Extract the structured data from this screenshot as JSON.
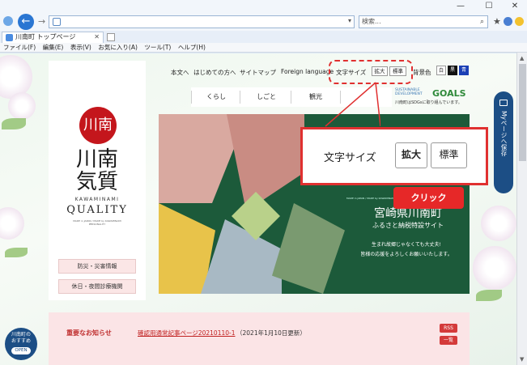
{
  "browser": {
    "tab_title": "川南町 トップページ",
    "search_placeholder": "検索...",
    "menu": [
      "ファイル(F)",
      "編集(E)",
      "表示(V)",
      "お気に入り(A)",
      "ツール(T)",
      "ヘルプ(H)"
    ],
    "controls": {
      "minimize": "—",
      "maximize": "☐",
      "close": "✕"
    }
  },
  "topnav": {
    "links": [
      "本文へ",
      "はじめての方へ",
      "サイトマップ",
      "Foreign language"
    ],
    "font_size_label": "文字サイズ",
    "font_large": "拡大",
    "font_normal": "標準",
    "bg_color_label": "背景色",
    "bg_white": "白",
    "bg_black": "黒",
    "bg_blue": "青"
  },
  "mainnav": [
    "くらし",
    "しごと",
    "観光"
  ],
  "sdg": {
    "top": "SUSTAINABLE DEVELOPMENT",
    "goals": "GOALS",
    "sub": "川南町はSDGsに取り組んでいます。"
  },
  "logo": {
    "mark": "川南",
    "text": "川南\n気質",
    "kana": "KAWAMINAMI",
    "quality": "QUALITY",
    "tiny": "MADE in JAPAN / MADE by KAWAMINAMI PERSONALITY"
  },
  "sidebar": {
    "disaster": "防災・災害情報",
    "medical": "休日・夜間診療機関"
  },
  "hero": {
    "title": "宮崎県川南町",
    "subtitle": "ふるさと納税特設サイト",
    "msg1": "生まれ故郷じゃなくても大丈夫!",
    "msg2": "皆様の応援をよろしくお願いいたします。",
    "tiny": "MADE in JAPAN / MADE by KAWAMINAMI PERSONALITY"
  },
  "zoom": {
    "label": "文字サイズ",
    "large": "拡大",
    "normal": "標準",
    "click": "クリック"
  },
  "mypage": "Myページへ保存",
  "notice": {
    "title": "重要なお知らせ",
    "link": "確認用通常記事ページ20210110-1",
    "date": "（2021年1月10日更新）",
    "rss": "RSS",
    "list": "一覧"
  },
  "recommend": {
    "label": "川南町の\nおすすめ",
    "open": "OPEN"
  },
  "colors": {
    "accent_red": "#e03030",
    "brand_blue": "#1c4e85",
    "hero_green": "#1c5a3a",
    "notice_pink": "#fbe4e6"
  }
}
